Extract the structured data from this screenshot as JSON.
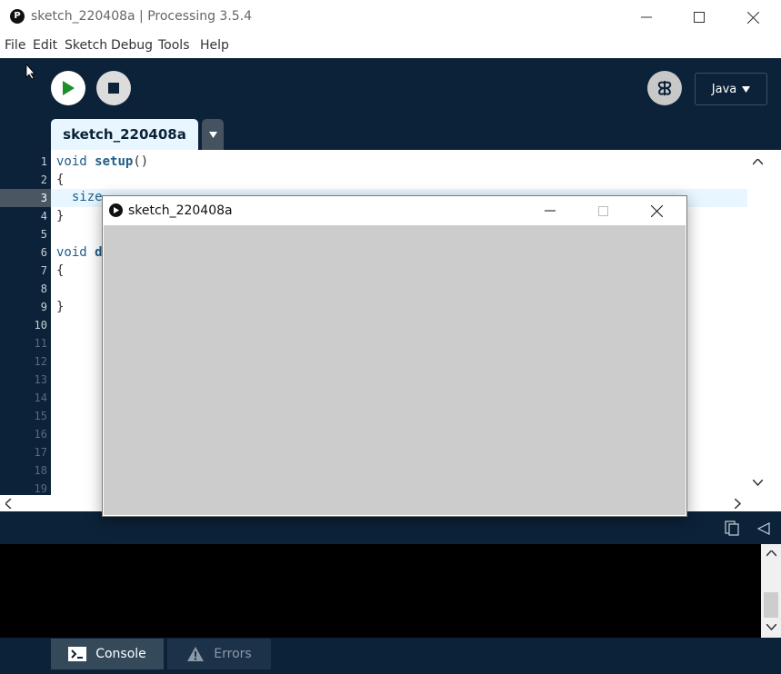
{
  "window": {
    "title": "sketch_220408a | Processing 3.5.4"
  },
  "menu": [
    "File",
    "Edit",
    "Sketch",
    "Debug",
    "Tools",
    "Help"
  ],
  "toolbar": {
    "mode": "Java"
  },
  "tabs": {
    "active": "sketch_220408a"
  },
  "editor": {
    "line_numbers": [
      "1",
      "2",
      "3",
      "4",
      "5",
      "6",
      "7",
      "8",
      "9",
      "10",
      "11",
      "12",
      "13",
      "14",
      "15",
      "16",
      "17",
      "18",
      "19"
    ],
    "code": {
      "l1_kw": "void",
      "l1_fn": "setup",
      "l1_rest": "()",
      "l2": "{",
      "l3": "  size",
      "l4": "}",
      "l6_kw": "void",
      "l6_fn": "d",
      "l7": "{",
      "l9": "}"
    }
  },
  "sketch_window": {
    "title": "sketch_220408a"
  },
  "footer": {
    "console_label": "Console",
    "errors_label": "Errors"
  },
  "colors": {
    "ide_background": "#0b2238",
    "accent": "#e8f7ff",
    "run": "#1a8f2a",
    "canvas": "#cccccc"
  }
}
